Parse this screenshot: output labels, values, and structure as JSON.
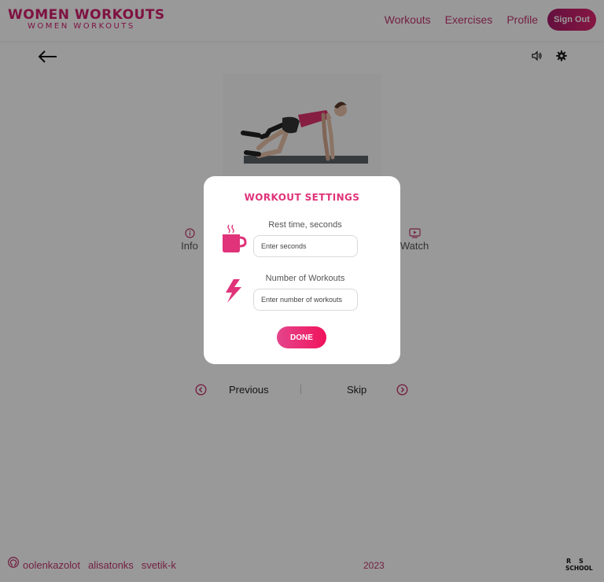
{
  "header": {
    "logo_main": "WOMEN WORKOUTS",
    "logo_sub": "WOMEN WORKOUTS",
    "nav": [
      "Workouts",
      "Exercises",
      "Profile"
    ],
    "signout_label": "Sign Out"
  },
  "main": {
    "info_label": "Info",
    "watch_label": "Watch",
    "prev_label": "Previous",
    "skip_label": "Skip"
  },
  "modal": {
    "title": "WORKOUT SETTINGS",
    "rest_label": "Rest time, seconds",
    "rest_placeholder": "Enter seconds",
    "num_label": "Number of Workouts",
    "num_placeholder": "Enter number of workouts",
    "done_label": "DONE"
  },
  "footer": {
    "authors": [
      "oolenkazolot",
      "alisatonks",
      "svetik-k"
    ],
    "year": "2023",
    "rs_logo_text": "RS SCHOOL"
  },
  "colors": {
    "brand": "#d21f6d",
    "accent_pink": "#e0337a",
    "overlay": "rgba(0,0,0,0.4)"
  },
  "icons": {
    "back": "arrow-left-icon",
    "sound": "speaker-icon",
    "settings": "gear-icon",
    "info": "info-circle-icon",
    "watch": "video-screen-icon",
    "prev": "chevron-left-circle-icon",
    "next": "chevron-right-circle-icon",
    "rest": "coffee-cup-icon",
    "workouts": "lightning-bolt-icon",
    "github": "github-icon"
  }
}
